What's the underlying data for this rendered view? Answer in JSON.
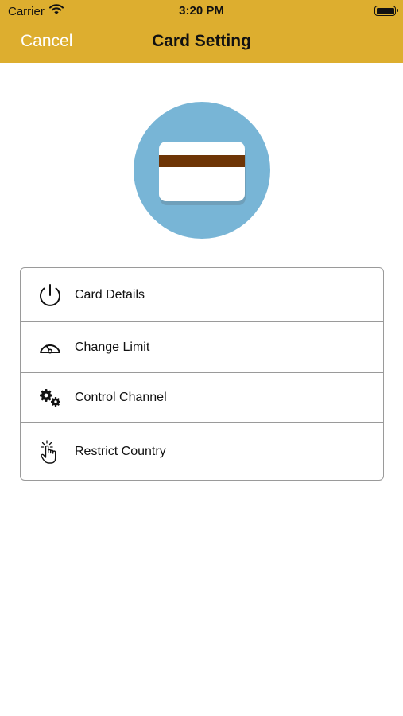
{
  "status_bar": {
    "carrier": "Carrier",
    "time": "3:20 PM",
    "icons": [
      "wifi-icon",
      "battery-icon"
    ]
  },
  "nav": {
    "cancel_label": "Cancel",
    "title": "Card Setting"
  },
  "hero": {
    "icon": "credit-card-icon"
  },
  "menu": {
    "items": [
      {
        "label": "Card Details",
        "icon": "power-icon"
      },
      {
        "label": "Change Limit",
        "icon": "speedometer-icon"
      },
      {
        "label": "Control Channel",
        "icon": "gears-icon"
      },
      {
        "label": "Restrict Country",
        "icon": "hand-pointer-icon"
      }
    ]
  },
  "colors": {
    "nav_background": "#ddae2f",
    "hero_circle": "#78b5d6",
    "card_stripe": "#6e3506",
    "card_shadow": "#6fa0bb"
  }
}
